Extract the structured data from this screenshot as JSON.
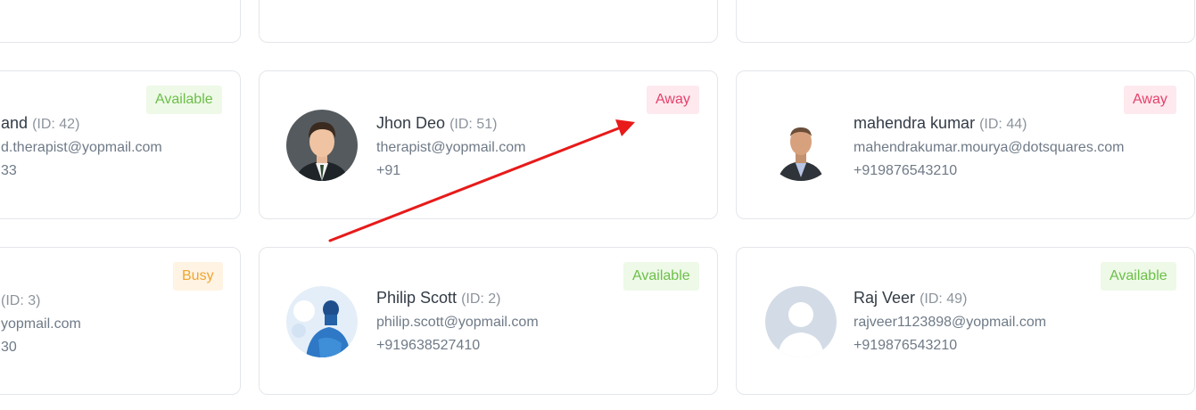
{
  "cards": {
    "r0c0": {},
    "r0c1": {},
    "r0c2": {},
    "r1c0": {
      "name_partial": "and",
      "id": "(ID: 42)",
      "email_partial": "d.therapist@yopmail.com",
      "phone_partial": "33",
      "status": "Available"
    },
    "r1c1": {
      "name": "Jhon Deo",
      "id": "(ID: 51)",
      "email": "therapist@yopmail.com",
      "phone": "+91",
      "status": "Away"
    },
    "r1c2": {
      "name": "mahendra kumar",
      "id": "(ID: 44)",
      "email": "mahendrakumar.mourya@dotsquares.com",
      "phone": "+919876543210",
      "status": "Away"
    },
    "r2c0": {
      "id_partial": "(ID: 3)",
      "email_partial": "yopmail.com",
      "phone_partial": "30",
      "status": "Busy"
    },
    "r2c1": {
      "name": "Philip Scott",
      "id": "(ID: 2)",
      "email": "philip.scott@yopmail.com",
      "phone": "+919638527410",
      "status": "Available"
    },
    "r2c2": {
      "name": "Raj Veer",
      "id": "(ID: 49)",
      "email": "rajveer1123898@yopmail.com",
      "phone": "+919876543210",
      "status": "Available"
    }
  },
  "colors": {
    "available": "#6cbf48",
    "away": "#e6406a",
    "busy": "#f0a531",
    "annotation_arrow": "#e81a1a"
  },
  "annotation": {
    "type": "arrow",
    "color": "#e81a1a"
  }
}
